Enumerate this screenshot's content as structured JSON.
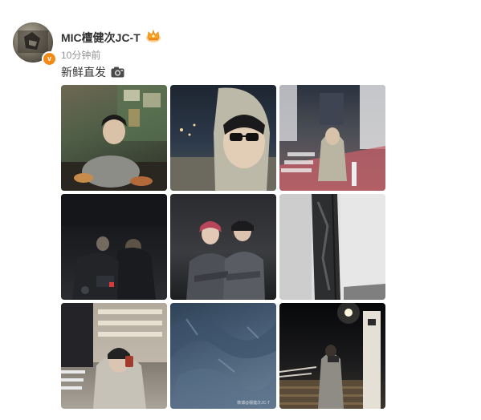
{
  "post": {
    "username": "MIC檀健次JC-T",
    "timestamp": "10分钟前",
    "text": "新鲜直发",
    "verified_badge": "v",
    "badge_icon": "crown-icon",
    "emoji_icon": "camera-icon"
  },
  "photos": [
    {
      "name": "photo-restaurant-dinner",
      "watermark": ""
    },
    {
      "name": "photo-hood-selfie-night",
      "watermark": ""
    },
    {
      "name": "photo-street-crosswalk",
      "watermark": ""
    },
    {
      "name": "photo-dark-crew",
      "watermark": ""
    },
    {
      "name": "photo-two-people-studio",
      "watermark": ""
    },
    {
      "name": "photo-fabric-closeup",
      "watermark": ""
    },
    {
      "name": "photo-building-selfie",
      "watermark": ""
    },
    {
      "name": "photo-blue-texture",
      "watermark": "微博@檀健次JC-T"
    },
    {
      "name": "photo-night-stairs",
      "watermark": ""
    }
  ],
  "colors": {
    "username": "#333333",
    "timestamp": "#939393",
    "verified": "#f38a18"
  }
}
